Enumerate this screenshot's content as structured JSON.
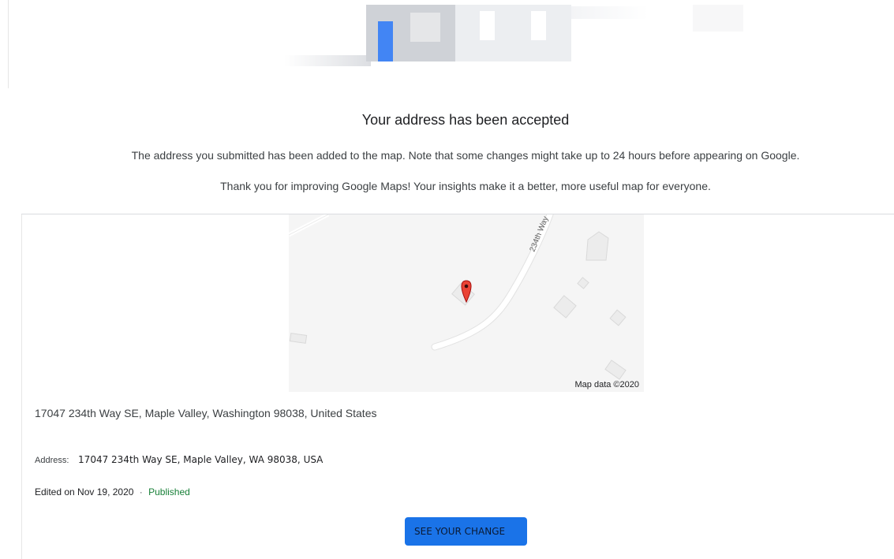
{
  "confirmation": {
    "title": "Your address has been accepted",
    "description": "The address you submitted has been added to the map. Note that some changes might take up to 24 hours before appearing on Google.",
    "thanks": "Thank you for improving Google Maps! Your insights make it a better, more useful map for everyone."
  },
  "map": {
    "road_label": "234th Way",
    "attribution": "Map data ©2020",
    "pin_color": "#ea4335"
  },
  "place": {
    "full_address": "17047 234th Way SE, Maple Valley, Washington 98038, United States",
    "address_label": "Address:",
    "address_value": "17047 234th Way SE, Maple Valley, WA 98038, USA",
    "edited_text": "Edited on Nov 19, 2020",
    "separator": "·",
    "status": "Published",
    "status_color": "#188038"
  },
  "actions": {
    "see_change_label": "SEE YOUR CHANGE",
    "accent_color": "#1a73e8"
  }
}
